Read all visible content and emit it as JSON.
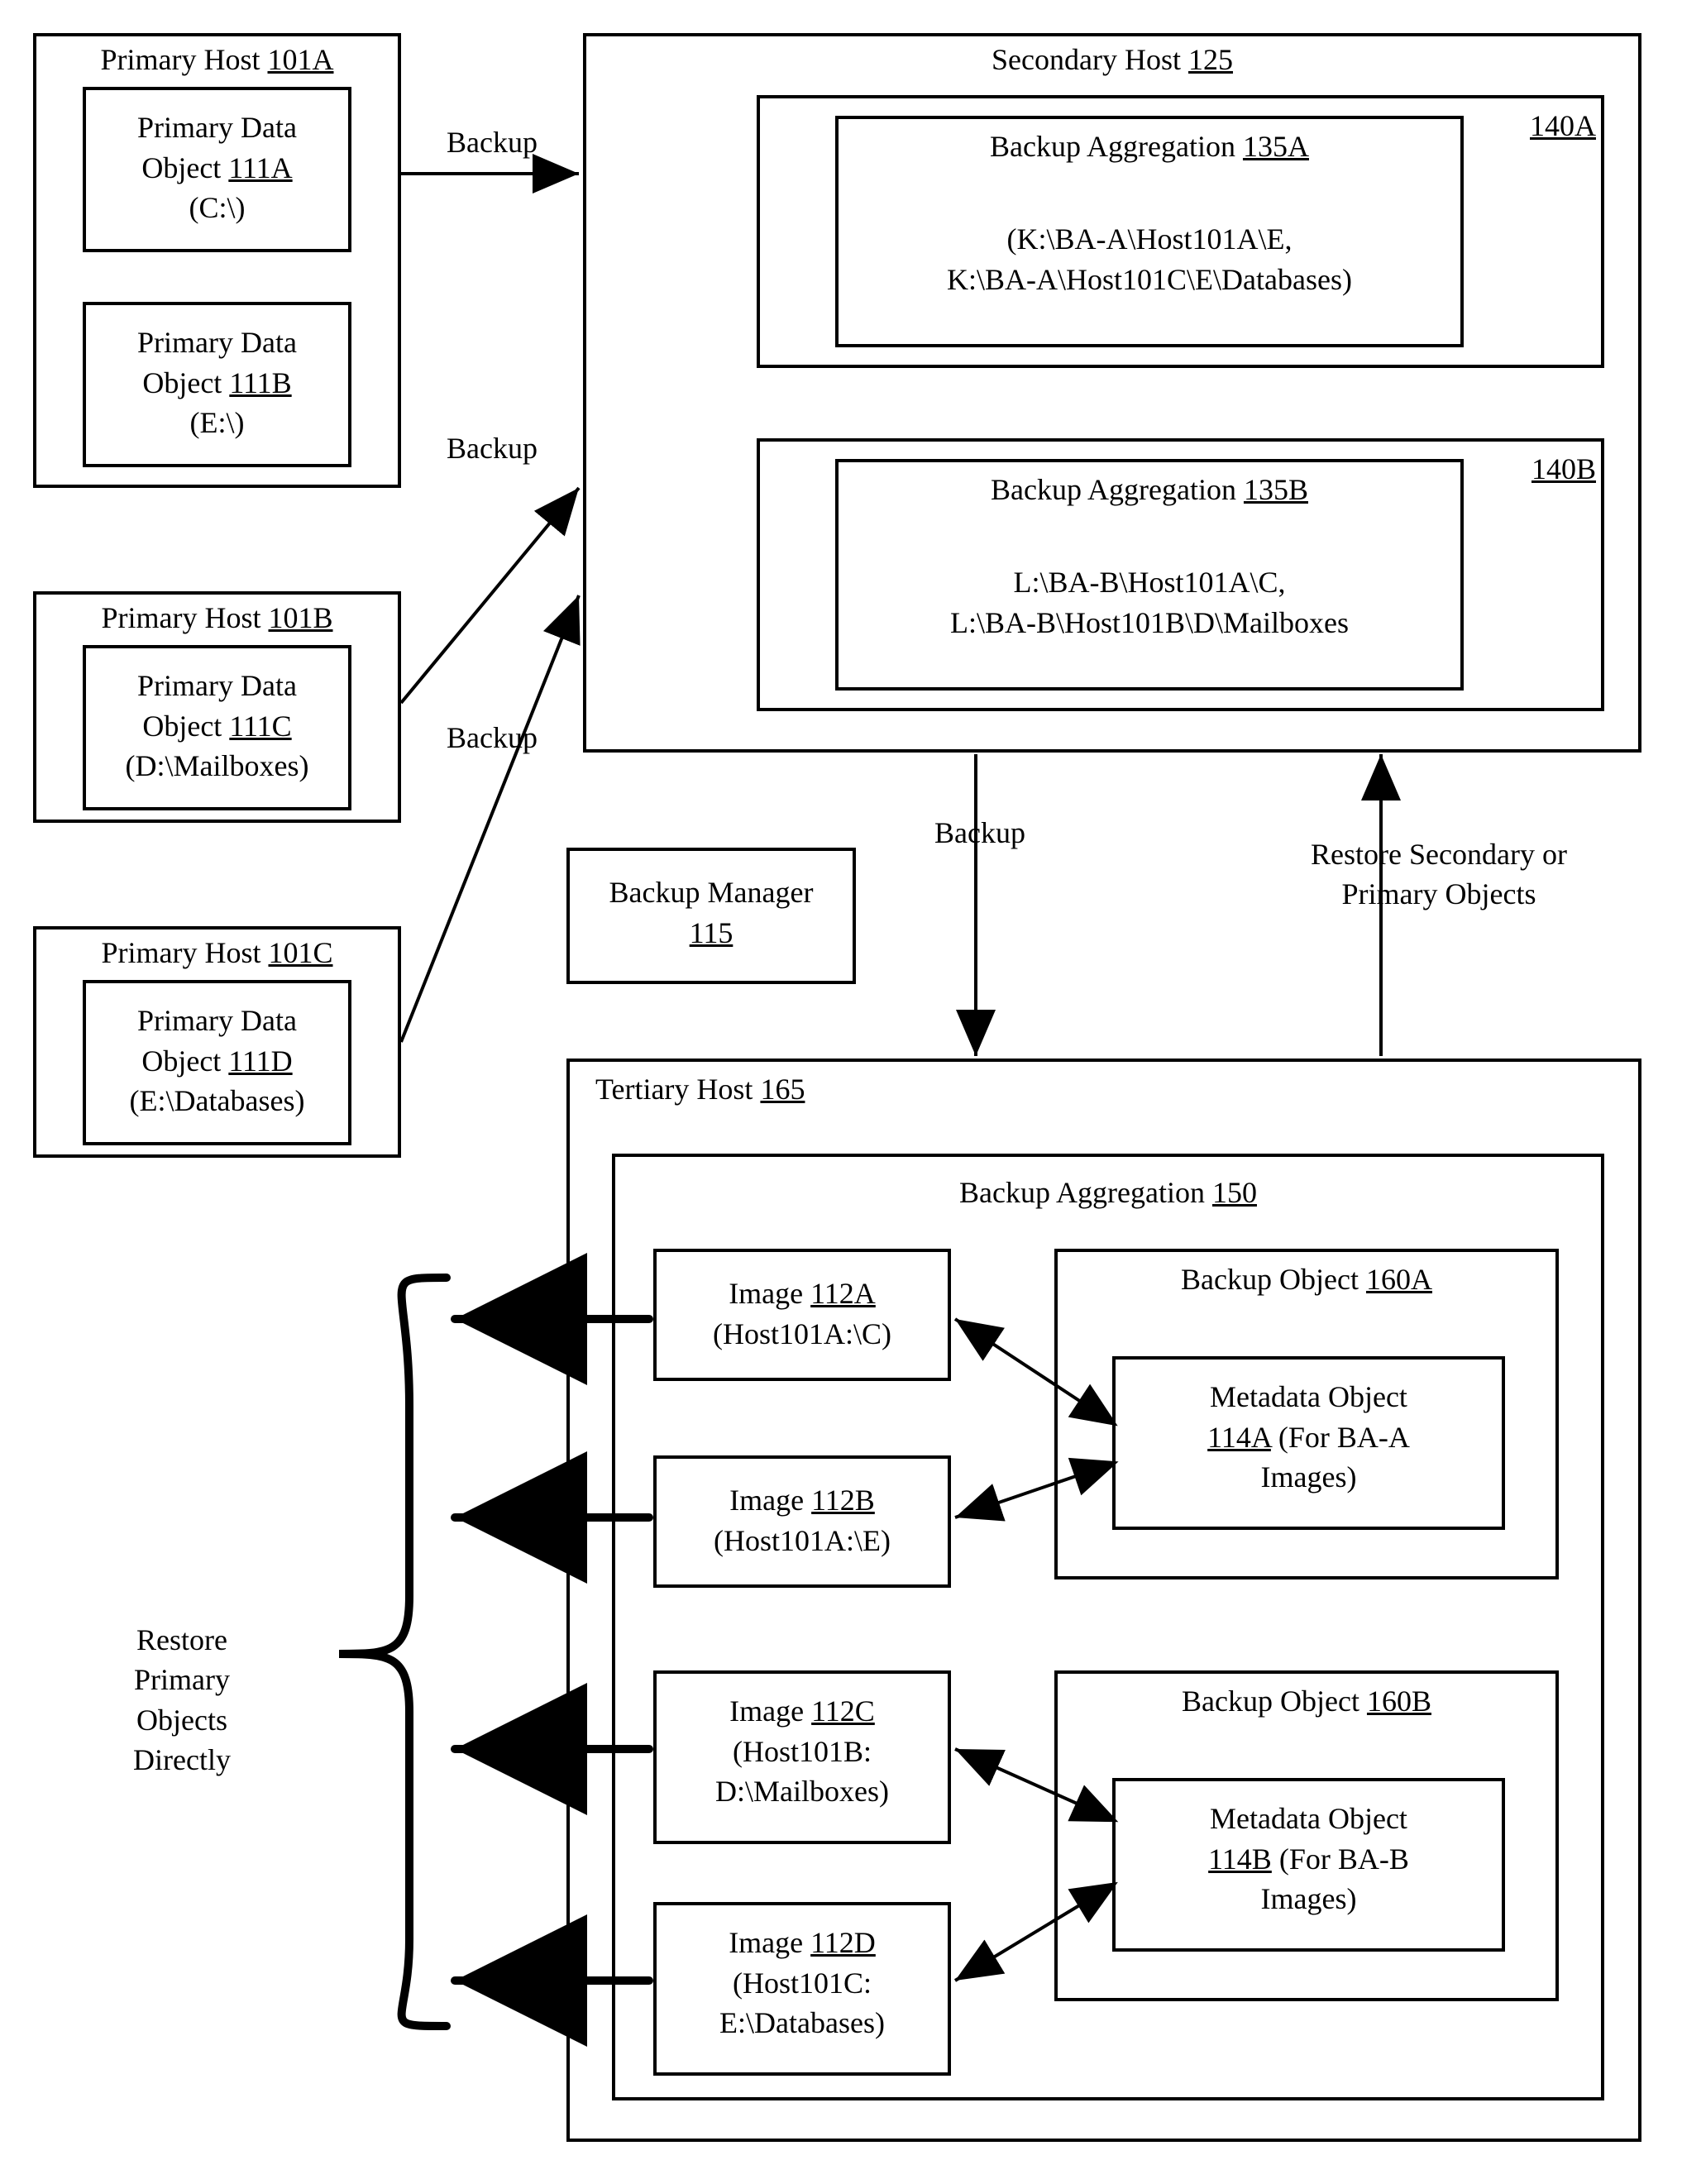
{
  "primaryHostA": {
    "title_prefix": "Primary Host ",
    "ref": "101A"
  },
  "primaryHostB": {
    "title_prefix": "Primary Host ",
    "ref": "101B"
  },
  "primaryHostC": {
    "title_prefix": "Primary Host ",
    "ref": "101C"
  },
  "pdoA": {
    "l1": "Primary Data",
    "l2_prefix": "Object ",
    "ref": "111A",
    "l3": "(C:\\)"
  },
  "pdoB": {
    "l1": "Primary Data",
    "l2_prefix": "Object ",
    "ref": "111B",
    "l3": "(E:\\)"
  },
  "pdoC": {
    "l1": "Primary Data",
    "l2_prefix": "Object ",
    "ref": "111C",
    "l3": "(D:\\Mailboxes)"
  },
  "pdoD": {
    "l1": "Primary Data",
    "l2_prefix": "Object ",
    "ref": "111D",
    "l3": "(E:\\Databases)"
  },
  "secondaryHost": {
    "title_prefix": "Secondary Host  ",
    "ref": "125"
  },
  "vol140A": {
    "ref": "140A"
  },
  "vol140B": {
    "ref": "140B"
  },
  "baA": {
    "title_prefix": "Backup Aggregation  ",
    "ref": "135A",
    "body1": "(K:\\BA-A\\Host101A\\E,",
    "body2": "K:\\BA-A\\Host101C\\E\\Databases)"
  },
  "baB": {
    "title_prefix": "Backup Aggregation  ",
    "ref": "135B",
    "body1": "L:\\BA-B\\Host101A\\C,",
    "body2": "L:\\BA-B\\Host101B\\D\\Mailboxes"
  },
  "backupManager": {
    "l1": "Backup Manager",
    "ref": "115"
  },
  "tertiaryHost": {
    "title_prefix": "Tertiary Host ",
    "ref": "165"
  },
  "ba150": {
    "title_prefix": "Backup Aggregation ",
    "ref": "150"
  },
  "img112A": {
    "l1_prefix": "Image ",
    "ref": "112A",
    "l2": "(Host101A:\\C)"
  },
  "img112B": {
    "l1_prefix": "Image ",
    "ref": "112B",
    "l2": "(Host101A:\\E)"
  },
  "img112C": {
    "l1_prefix": "Image ",
    "ref": "112C",
    "l2": "(Host101B:",
    "l3": "D:\\Mailboxes)"
  },
  "img112D": {
    "l1_prefix": "Image ",
    "ref": "112D",
    "l2": "(Host101C:",
    "l3": "E:\\Databases)"
  },
  "bobj160A": {
    "title_prefix": "Backup Object ",
    "ref": "160A"
  },
  "bobj160B": {
    "title_prefix": "Backup Object ",
    "ref": "160B"
  },
  "meta114A": {
    "l1": "Metadata Object",
    "ref": "114A",
    "suffix": "  (For BA-A",
    "l3": "Images)"
  },
  "meta114B": {
    "l1": "Metadata Object",
    "ref": "114B",
    "suffix": "  (For BA-B",
    "l3": "Images)"
  },
  "arrowLabels": {
    "backup1": "Backup",
    "backup2": "Backup",
    "backup3": "Backup",
    "backup4": "Backup",
    "restoreRight": "Restore Secondary or\nPrimary Objects",
    "restoreLeft": "Restore\nPrimary\nObjects\nDirectly"
  }
}
